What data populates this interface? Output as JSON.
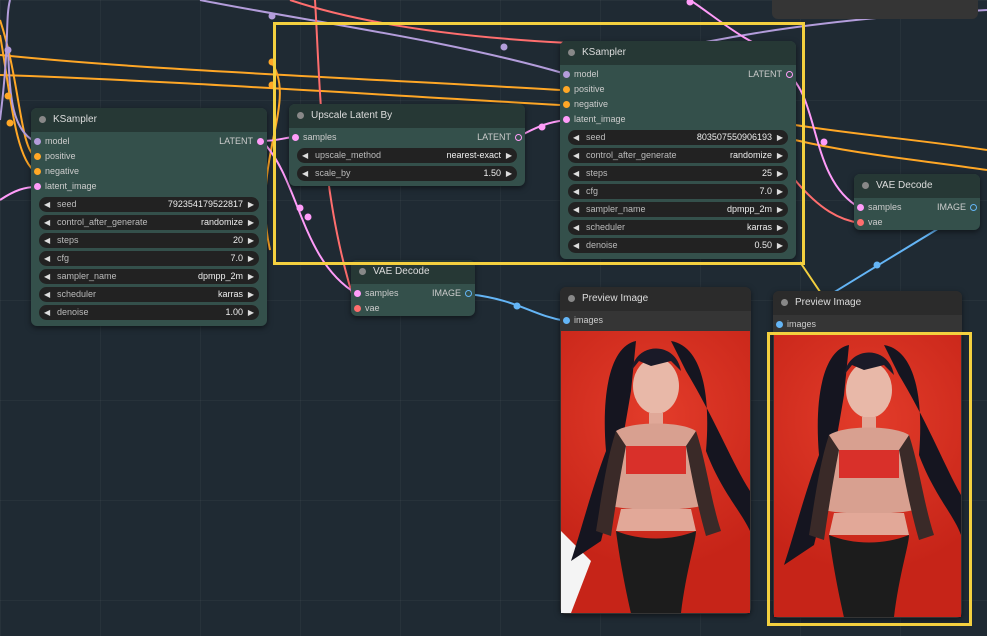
{
  "colors": {
    "model": "#b39ddb",
    "clip": "#ffa726",
    "latent": "#ff9cf9",
    "vae": "#ff6e6e",
    "image": "#64b5f6",
    "highlight": "#f4d03f"
  },
  "ks1": {
    "title": "KSampler",
    "inputs": [
      "model",
      "positive",
      "negative",
      "latent_image"
    ],
    "output": "LATENT",
    "widgets": [
      {
        "label": "seed",
        "value": "792354179522817"
      },
      {
        "label": "control_after_generate",
        "value": "randomize"
      },
      {
        "label": "steps",
        "value": "20"
      },
      {
        "label": "cfg",
        "value": "7.0"
      },
      {
        "label": "sampler_name",
        "value": "dpmpp_2m"
      },
      {
        "label": "scheduler",
        "value": "karras"
      },
      {
        "label": "denoise",
        "value": "1.00"
      }
    ]
  },
  "upscale": {
    "title": "Upscale Latent By",
    "input": "samples",
    "output": "LATENT",
    "widgets": [
      {
        "label": "upscale_method",
        "value": "nearest-exact"
      },
      {
        "label": "scale_by",
        "value": "1.50"
      }
    ]
  },
  "ks2": {
    "title": "KSampler",
    "inputs": [
      "model",
      "positive",
      "negative",
      "latent_image"
    ],
    "output": "LATENT",
    "widgets": [
      {
        "label": "seed",
        "value": "803507550906193"
      },
      {
        "label": "control_after_generate",
        "value": "randomize"
      },
      {
        "label": "steps",
        "value": "25"
      },
      {
        "label": "cfg",
        "value": "7.0"
      },
      {
        "label": "sampler_name",
        "value": "dpmpp_2m"
      },
      {
        "label": "scheduler",
        "value": "karras"
      },
      {
        "label": "denoise",
        "value": "0.50"
      }
    ]
  },
  "vae1": {
    "title": "VAE Decode",
    "inputs": [
      "samples",
      "vae"
    ],
    "output": "IMAGE"
  },
  "vae2": {
    "title": "VAE Decode",
    "inputs": [
      "samples",
      "vae"
    ],
    "output": "IMAGE"
  },
  "preview1": {
    "title": "Preview Image",
    "input": "images"
  },
  "preview2": {
    "title": "Preview Image",
    "input": "images"
  }
}
